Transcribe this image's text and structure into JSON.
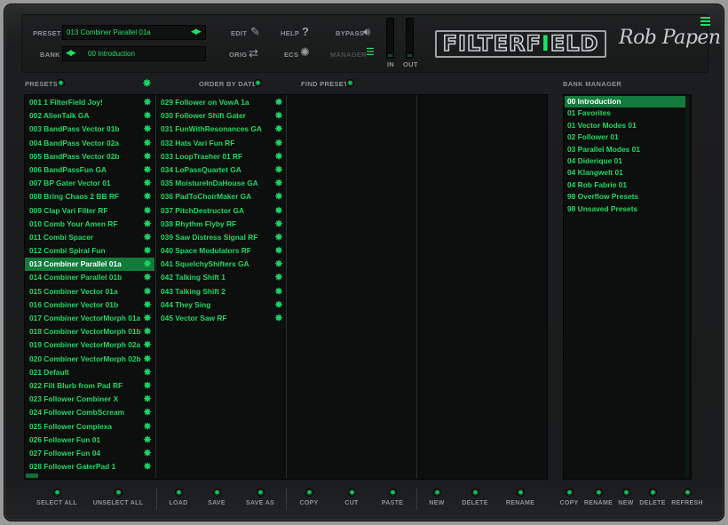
{
  "header": {
    "preset_label": "PRESET",
    "preset_value": "013 Combiner Parallel 01a",
    "bank_label": "BANK",
    "bank_value": "00 Introduction",
    "edit_label": "EDIT",
    "orig_label": "ORIG",
    "help_label": "HELP",
    "ecs_label": "ECS",
    "bypass_label": "BYPASS",
    "manager_label": "MANAGER",
    "in_label": "IN",
    "out_label": "OUT",
    "logo_left": "FILTER",
    "logo_right": "F",
    "logo_dot": "I",
    "logo_end": "ELD",
    "signature": "Rob Papen"
  },
  "toolbar": {
    "presets_label": "PRESETS",
    "order_label": "ORDER BY DATE",
    "find_label": "FIND PRESET",
    "bank_manager_label": "BANK MANAGER"
  },
  "presets_col1": [
    "001 1 FilterField Joy!",
    "002 AlienTalk GA",
    "003 BandPass Vector 01b",
    "004 BandPass Vector 02a",
    "005 BandPass Vector 02b",
    "006 BandPassFun GA",
    "007 BP Gater Vector 01",
    "008 Bring Chaos 2 BB RF",
    "009 Clap Vari Filter RF",
    "010 Comb Your Amen RF",
    "011 Combi Spacer",
    "012 Combi Spiral Fun",
    "013 Combiner Parallel 01a",
    "014 Combiner Parallel 01b",
    "015 Combiner Vector 01a",
    "016 Combiner Vector 01b",
    "017 Combiner VectorMorph 01a",
    "018 Combiner VectorMorph 01b",
    "019 Combiner VectorMorph 02a",
    "020 Combiner VectorMorph 02b",
    "021 Default",
    "022 Filt Blurb from Pad RF",
    "023 Follower Combiner X",
    "024 Follower CombScream",
    "025 Follower Complexa",
    "026 Follower Fun 01",
    "027 Follower Fun 04",
    "028 Follower GaterPad 1"
  ],
  "presets_col2": [
    "029 Follower on VowA 1a",
    "030 Follower Shift Gater",
    "031 FunWithResonances GA",
    "032 Hats Vari Fun RF",
    "033 LoopTrasher 01 RF",
    "034 LoPassQuartet GA",
    "035 MoistureInDaHouse GA",
    "036 PadToChoirMaker GA",
    "037 PitchDestructor GA",
    "038 Rhythm Flyby RF",
    "039 Saw Distress Signal RF",
    "040 Space Modulators RF",
    "041 SquelchyShifters GA",
    "042 Talking Shift 1",
    "043 Talking Shift 2",
    "044 They Sing",
    "045 Vector Saw RF"
  ],
  "selected_preset": "013 Combiner Parallel 01a",
  "banks": [
    "00 Introduction",
    "01 Favorites",
    "01 Vector Modes 01",
    "02 Follower 01",
    "03 Parallel Modes 01",
    "04 Diderique 01",
    "04 Klangwelt 01",
    "04 Rob Fabrie 01",
    "98 Overflow Presets",
    "98 Unsaved Presets"
  ],
  "selected_bank": "00 Introduction",
  "buttons": {
    "select_all": "SELECT ALL",
    "unselect_all": "UNSELECT ALL",
    "load": "LOAD",
    "save": "SAVE",
    "save_as": "SAVE AS",
    "copy": "COPY",
    "cut": "CUT",
    "paste": "PASTE",
    "new": "NEW",
    "delete": "DELETE",
    "rename": "RENAME",
    "bank_copy": "COPY",
    "bank_rename": "RENAME",
    "bank_new": "NEW",
    "bank_delete": "DELETE",
    "bank_refresh": "REFRESH"
  },
  "colors": {
    "accent_green": "#1ee06a",
    "selection": "#137a3b",
    "background": "#1a1b1c"
  }
}
